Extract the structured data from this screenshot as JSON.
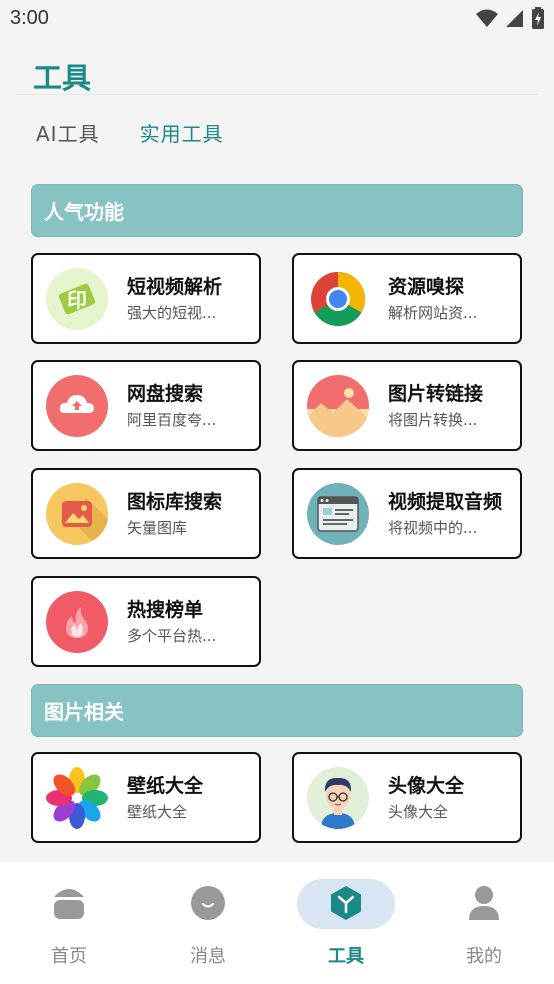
{
  "status": {
    "time": "3:00"
  },
  "page": {
    "title": "工具"
  },
  "tabs": [
    {
      "label": "AI工具",
      "active": false
    },
    {
      "label": "实用工具",
      "active": true
    }
  ],
  "sections": [
    {
      "title": "人气功能",
      "cards": [
        {
          "title": "短视频解析",
          "desc": "强大的短视...",
          "icon": "video-parse-icon"
        },
        {
          "title": "资源嗅探",
          "desc": "解析网站资...",
          "icon": "chrome-icon"
        },
        {
          "title": "网盘搜索",
          "desc": "阿里百度夸...",
          "icon": "cloud-upload-icon"
        },
        {
          "title": "图片转链接",
          "desc": "将图片转换...",
          "icon": "image-icon"
        },
        {
          "title": "图标库搜索",
          "desc": "矢量图库",
          "icon": "icon-library-icon"
        },
        {
          "title": "视频提取音频",
          "desc": "将视频中的...",
          "icon": "video-audio-icon"
        },
        {
          "title": "热搜榜单",
          "desc": "多个平台热...",
          "icon": "fire-icon"
        }
      ]
    },
    {
      "title": "图片相关",
      "cards": [
        {
          "title": "壁纸大全",
          "desc": "壁纸大全",
          "icon": "wallpaper-icon"
        },
        {
          "title": "头像大全",
          "desc": "头像大全",
          "icon": "avatar-icon"
        }
      ]
    }
  ],
  "bottom_nav": [
    {
      "label": "首页",
      "icon": "home-icon",
      "active": false
    },
    {
      "label": "消息",
      "icon": "message-icon",
      "active": false
    },
    {
      "label": "工具",
      "icon": "tools-icon",
      "active": true
    },
    {
      "label": "我的",
      "icon": "profile-icon",
      "active": false
    }
  ],
  "colors": {
    "accent": "#1a8a86",
    "section_header": "#86c3c2",
    "nav_pill": "#d8e6f4"
  }
}
